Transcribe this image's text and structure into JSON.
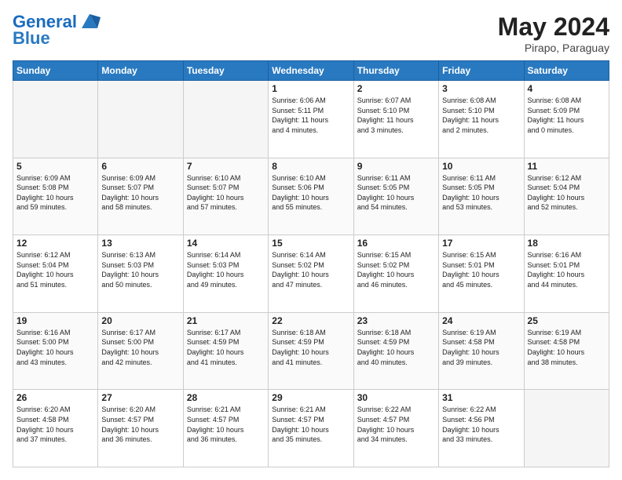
{
  "header": {
    "logo_general": "General",
    "logo_blue": "Blue",
    "month_year": "May 2024",
    "location": "Pirapo, Paraguay"
  },
  "weekdays": [
    "Sunday",
    "Monday",
    "Tuesday",
    "Wednesday",
    "Thursday",
    "Friday",
    "Saturday"
  ],
  "weeks": [
    [
      {
        "day": "",
        "info": ""
      },
      {
        "day": "",
        "info": ""
      },
      {
        "day": "",
        "info": ""
      },
      {
        "day": "1",
        "info": "Sunrise: 6:06 AM\nSunset: 5:11 PM\nDaylight: 11 hours\nand 4 minutes."
      },
      {
        "day": "2",
        "info": "Sunrise: 6:07 AM\nSunset: 5:10 PM\nDaylight: 11 hours\nand 3 minutes."
      },
      {
        "day": "3",
        "info": "Sunrise: 6:08 AM\nSunset: 5:10 PM\nDaylight: 11 hours\nand 2 minutes."
      },
      {
        "day": "4",
        "info": "Sunrise: 6:08 AM\nSunset: 5:09 PM\nDaylight: 11 hours\nand 0 minutes."
      }
    ],
    [
      {
        "day": "5",
        "info": "Sunrise: 6:09 AM\nSunset: 5:08 PM\nDaylight: 10 hours\nand 59 minutes."
      },
      {
        "day": "6",
        "info": "Sunrise: 6:09 AM\nSunset: 5:07 PM\nDaylight: 10 hours\nand 58 minutes."
      },
      {
        "day": "7",
        "info": "Sunrise: 6:10 AM\nSunset: 5:07 PM\nDaylight: 10 hours\nand 57 minutes."
      },
      {
        "day": "8",
        "info": "Sunrise: 6:10 AM\nSunset: 5:06 PM\nDaylight: 10 hours\nand 55 minutes."
      },
      {
        "day": "9",
        "info": "Sunrise: 6:11 AM\nSunset: 5:05 PM\nDaylight: 10 hours\nand 54 minutes."
      },
      {
        "day": "10",
        "info": "Sunrise: 6:11 AM\nSunset: 5:05 PM\nDaylight: 10 hours\nand 53 minutes."
      },
      {
        "day": "11",
        "info": "Sunrise: 6:12 AM\nSunset: 5:04 PM\nDaylight: 10 hours\nand 52 minutes."
      }
    ],
    [
      {
        "day": "12",
        "info": "Sunrise: 6:12 AM\nSunset: 5:04 PM\nDaylight: 10 hours\nand 51 minutes."
      },
      {
        "day": "13",
        "info": "Sunrise: 6:13 AM\nSunset: 5:03 PM\nDaylight: 10 hours\nand 50 minutes."
      },
      {
        "day": "14",
        "info": "Sunrise: 6:14 AM\nSunset: 5:03 PM\nDaylight: 10 hours\nand 49 minutes."
      },
      {
        "day": "15",
        "info": "Sunrise: 6:14 AM\nSunset: 5:02 PM\nDaylight: 10 hours\nand 47 minutes."
      },
      {
        "day": "16",
        "info": "Sunrise: 6:15 AM\nSunset: 5:02 PM\nDaylight: 10 hours\nand 46 minutes."
      },
      {
        "day": "17",
        "info": "Sunrise: 6:15 AM\nSunset: 5:01 PM\nDaylight: 10 hours\nand 45 minutes."
      },
      {
        "day": "18",
        "info": "Sunrise: 6:16 AM\nSunset: 5:01 PM\nDaylight: 10 hours\nand 44 minutes."
      }
    ],
    [
      {
        "day": "19",
        "info": "Sunrise: 6:16 AM\nSunset: 5:00 PM\nDaylight: 10 hours\nand 43 minutes."
      },
      {
        "day": "20",
        "info": "Sunrise: 6:17 AM\nSunset: 5:00 PM\nDaylight: 10 hours\nand 42 minutes."
      },
      {
        "day": "21",
        "info": "Sunrise: 6:17 AM\nSunset: 4:59 PM\nDaylight: 10 hours\nand 41 minutes."
      },
      {
        "day": "22",
        "info": "Sunrise: 6:18 AM\nSunset: 4:59 PM\nDaylight: 10 hours\nand 41 minutes."
      },
      {
        "day": "23",
        "info": "Sunrise: 6:18 AM\nSunset: 4:59 PM\nDaylight: 10 hours\nand 40 minutes."
      },
      {
        "day": "24",
        "info": "Sunrise: 6:19 AM\nSunset: 4:58 PM\nDaylight: 10 hours\nand 39 minutes."
      },
      {
        "day": "25",
        "info": "Sunrise: 6:19 AM\nSunset: 4:58 PM\nDaylight: 10 hours\nand 38 minutes."
      }
    ],
    [
      {
        "day": "26",
        "info": "Sunrise: 6:20 AM\nSunset: 4:58 PM\nDaylight: 10 hours\nand 37 minutes."
      },
      {
        "day": "27",
        "info": "Sunrise: 6:20 AM\nSunset: 4:57 PM\nDaylight: 10 hours\nand 36 minutes."
      },
      {
        "day": "28",
        "info": "Sunrise: 6:21 AM\nSunset: 4:57 PM\nDaylight: 10 hours\nand 36 minutes."
      },
      {
        "day": "29",
        "info": "Sunrise: 6:21 AM\nSunset: 4:57 PM\nDaylight: 10 hours\nand 35 minutes."
      },
      {
        "day": "30",
        "info": "Sunrise: 6:22 AM\nSunset: 4:57 PM\nDaylight: 10 hours\nand 34 minutes."
      },
      {
        "day": "31",
        "info": "Sunrise: 6:22 AM\nSunset: 4:56 PM\nDaylight: 10 hours\nand 33 minutes."
      },
      {
        "day": "",
        "info": ""
      }
    ]
  ]
}
